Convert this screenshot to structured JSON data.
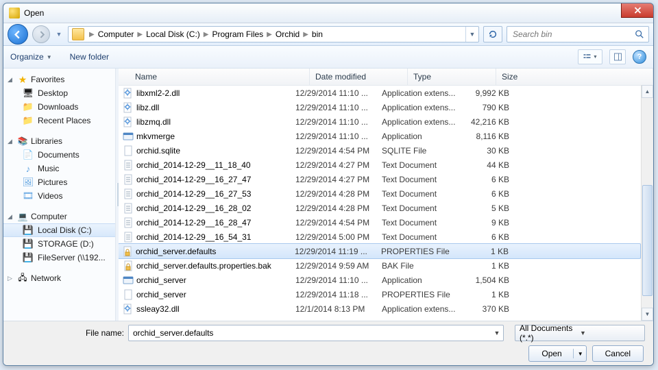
{
  "window": {
    "title": "Open"
  },
  "breadcrumb": {
    "segs": [
      "Computer",
      "Local Disk (C:)",
      "Program Files",
      "Orchid",
      "bin"
    ]
  },
  "search": {
    "placeholder": "Search bin"
  },
  "toolbar": {
    "organize": "Organize",
    "newfolder": "New folder"
  },
  "sidebar": {
    "favorites": {
      "label": "Favorites",
      "items": [
        "Desktop",
        "Downloads",
        "Recent Places"
      ]
    },
    "libraries": {
      "label": "Libraries",
      "items": [
        "Documents",
        "Music",
        "Pictures",
        "Videos"
      ]
    },
    "computer": {
      "label": "Computer",
      "items": [
        "Local Disk (C:)",
        "STORAGE (D:)",
        "FileServer (\\\\192..."
      ]
    },
    "network": {
      "label": "Network"
    }
  },
  "columns": {
    "name": "Name",
    "date": "Date modified",
    "type": "Type",
    "size": "Size"
  },
  "rows": [
    {
      "icon": "dll",
      "name": "libxml2-2.dll",
      "date": "12/29/2014 11:10 ...",
      "type": "Application extens...",
      "size": "9,992 KB"
    },
    {
      "icon": "dll",
      "name": "libz.dll",
      "date": "12/29/2014 11:10 ...",
      "type": "Application extens...",
      "size": "790 KB"
    },
    {
      "icon": "dll",
      "name": "libzmq.dll",
      "date": "12/29/2014 11:10 ...",
      "type": "Application extens...",
      "size": "42,216 KB"
    },
    {
      "icon": "exe",
      "name": "mkvmerge",
      "date": "12/29/2014 11:10 ...",
      "type": "Application",
      "size": "8,116 KB"
    },
    {
      "icon": "file",
      "name": "orchid.sqlite",
      "date": "12/29/2014 4:54 PM",
      "type": "SQLITE File",
      "size": "30 KB"
    },
    {
      "icon": "txt",
      "name": "orchid_2014-12-29__11_18_40",
      "date": "12/29/2014 4:27 PM",
      "type": "Text Document",
      "size": "44 KB"
    },
    {
      "icon": "txt",
      "name": "orchid_2014-12-29__16_27_47",
      "date": "12/29/2014 4:27 PM",
      "type": "Text Document",
      "size": "6 KB"
    },
    {
      "icon": "txt",
      "name": "orchid_2014-12-29__16_27_53",
      "date": "12/29/2014 4:28 PM",
      "type": "Text Document",
      "size": "6 KB"
    },
    {
      "icon": "txt",
      "name": "orchid_2014-12-29__16_28_02",
      "date": "12/29/2014 4:28 PM",
      "type": "Text Document",
      "size": "5 KB"
    },
    {
      "icon": "txt",
      "name": "orchid_2014-12-29__16_28_47",
      "date": "12/29/2014 4:54 PM",
      "type": "Text Document",
      "size": "9 KB"
    },
    {
      "icon": "txt",
      "name": "orchid_2014-12-29__16_54_31",
      "date": "12/29/2014 5:00 PM",
      "type": "Text Document",
      "size": "6 KB"
    },
    {
      "icon": "lock",
      "name": "orchid_server.defaults",
      "date": "12/29/2014 11:19 ...",
      "type": "PROPERTIES File",
      "size": "1 KB",
      "sel": true
    },
    {
      "icon": "lock",
      "name": "orchid_server.defaults.properties.bak",
      "date": "12/29/2014 9:59 AM",
      "type": "BAK File",
      "size": "1 KB"
    },
    {
      "icon": "exe",
      "name": "orchid_server",
      "date": "12/29/2014 11:10 ...",
      "type": "Application",
      "size": "1,504 KB"
    },
    {
      "icon": "file",
      "name": "orchid_server",
      "date": "12/29/2014 11:18 ...",
      "type": "PROPERTIES File",
      "size": "1 KB"
    },
    {
      "icon": "dll",
      "name": "ssleay32.dll",
      "date": "12/1/2014 8:13 PM",
      "type": "Application extens...",
      "size": "370 KB"
    }
  ],
  "footer": {
    "filename_label": "File name:",
    "filename_value": "orchid_server.defaults",
    "filter": "All Documents (*.*)",
    "open": "Open",
    "cancel": "Cancel"
  }
}
